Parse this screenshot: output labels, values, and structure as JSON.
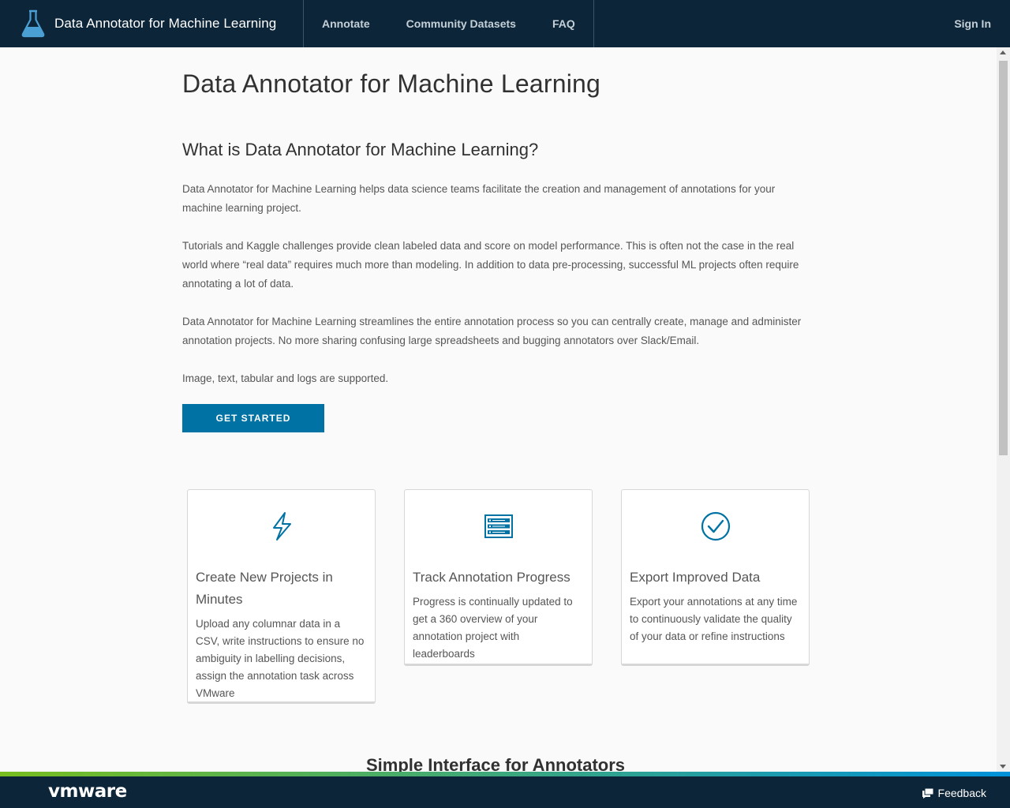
{
  "header": {
    "app_title": "Data Annotator for Machine Learning",
    "logo_icon": "flask-icon",
    "nav": [
      "Annotate",
      "Community Datasets",
      "FAQ"
    ],
    "sign_in": "Sign In"
  },
  "main": {
    "page_title": "Data Annotator for Machine Learning",
    "section_title": "What is Data Annotator for Machine Learning?",
    "paragraphs": [
      "Data Annotator for Machine Learning helps data science teams facilitate the creation and management of annotations for your machine learning project.",
      "Tutorials and Kaggle challenges provide clean labeled data and score on model performance. This is often not the case in the real world where “real data” requires much more than modeling. In addition to data pre-processing, successful ML projects often require annotating a lot of data.",
      "Data Annotator for Machine Learning streamlines the entire annotation process so you can centrally create, manage and administer annotation projects. No more sharing confusing large spreadsheets and bugging annotators over Slack/Email.",
      "Image, text, tabular and logs are supported."
    ],
    "cta_label": "GET STARTED",
    "cards": [
      {
        "icon": "lightning-bolt-icon",
        "title": "Create New Projects in Minutes",
        "text": "Upload any columnar data in a CSV, write instructions to ensure no ambiguity in labelling decisions, assign the annotation task across VMware"
      },
      {
        "icon": "server-list-icon",
        "title": "Track Annotation Progress",
        "text": "Progress is continually updated to get a 360 overview of your annotation project with leaderboards"
      },
      {
        "icon": "check-circle-icon",
        "title": "Export Improved Data",
        "text": "Export your annotations at any time to continuously validate the quality of your data or refine instructions"
      }
    ],
    "subheading": "Simple Interface for Annotators"
  },
  "footer": {
    "brand": "vmware",
    "feedback": "Feedback"
  },
  "colors": {
    "header_bg": "#0d2538",
    "primary_button": "#0072a3",
    "icon_blue": "#0072a3"
  }
}
